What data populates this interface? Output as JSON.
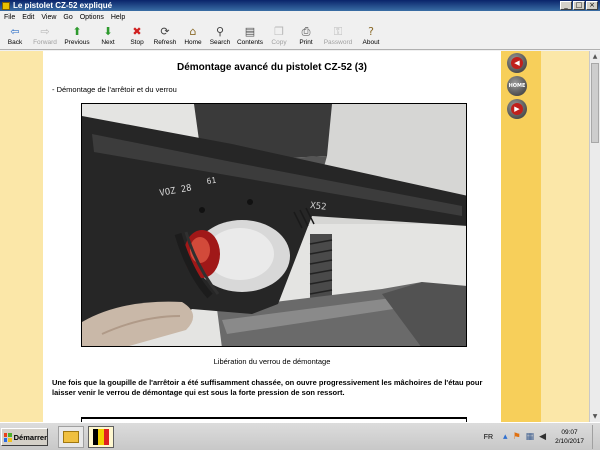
{
  "window": {
    "title": "Le pistolet CZ-52 expliqué",
    "controls": [
      "_",
      "□",
      "×"
    ]
  },
  "menu": [
    "File",
    "Edit",
    "View",
    "Go",
    "Options",
    "Help"
  ],
  "toolbar": [
    {
      "label": "Back",
      "icon": "arrow-left-icon",
      "glyph": "⇦",
      "color": "#2b6ec8",
      "enabled": true
    },
    {
      "label": "Forward",
      "icon": "arrow-right-icon",
      "glyph": "⇨",
      "color": "#b8b8b8",
      "enabled": false
    },
    {
      "label": "Previous",
      "icon": "arrow-up-icon",
      "glyph": "⬆",
      "color": "#2e9a2e",
      "enabled": true
    },
    {
      "label": "Next",
      "icon": "arrow-down-icon",
      "glyph": "⬇",
      "color": "#2e9a2e",
      "enabled": true
    },
    {
      "label": "Stop",
      "icon": "stop-icon",
      "glyph": "✖",
      "color": "#d02020",
      "enabled": true
    },
    {
      "label": "Refresh",
      "icon": "refresh-icon",
      "glyph": "⟳",
      "color": "#404040",
      "enabled": true
    },
    {
      "label": "Home",
      "icon": "home-icon",
      "glyph": "⌂",
      "color": "#8a6a2a",
      "enabled": true
    },
    {
      "label": "Search",
      "icon": "search-icon",
      "glyph": "⚲",
      "color": "#404040",
      "enabled": true
    },
    {
      "label": "Contents",
      "icon": "contents-icon",
      "glyph": "▤",
      "color": "#505050",
      "enabled": true
    },
    {
      "label": "Copy",
      "icon": "copy-icon",
      "glyph": "❐",
      "color": "#b8b8b8",
      "enabled": false
    },
    {
      "label": "Print",
      "icon": "print-icon",
      "glyph": "⎙",
      "color": "#404040",
      "enabled": true
    },
    {
      "label": "Password",
      "icon": "key-icon",
      "glyph": "⚿",
      "color": "#b8b8b8",
      "enabled": false
    },
    {
      "label": "About",
      "icon": "about-icon",
      "glyph": "?",
      "color": "#8a6a2a",
      "enabled": true
    }
  ],
  "page": {
    "heading": "Démontage avancé du pistolet CZ-52 (3)",
    "section_label": "- Démontage de l'arrêtoir et du verrou",
    "photo_caption": "Libération du verrou de démontage",
    "paragraph": "Une fois que la goupille de l'arrêtoir a été suffisamment chassée, on ouvre progressivement les mâchoires de l'étau pour laisser venir le verrou de démontage qui est sous la forte pression de son ressort.",
    "photo_markings": [
      "VOZ 28",
      "61",
      "X52"
    ]
  },
  "side_nav": [
    {
      "name": "previous-page-button",
      "icon": "arrow-left-icon",
      "glyph": "◀"
    },
    {
      "name": "home-page-button",
      "icon": "home-icon",
      "glyph": "HOME"
    },
    {
      "name": "next-page-button",
      "icon": "arrow-right-icon",
      "glyph": "▶"
    }
  ],
  "taskbar": {
    "start_label": "Démarrer",
    "language": "FR",
    "time": "09:07",
    "date": "2/10/2017"
  },
  "colors": {
    "page_background": "#fbe7a8",
    "side_band": "#f7cf5a",
    "nav_button_red": "#c0201c"
  }
}
